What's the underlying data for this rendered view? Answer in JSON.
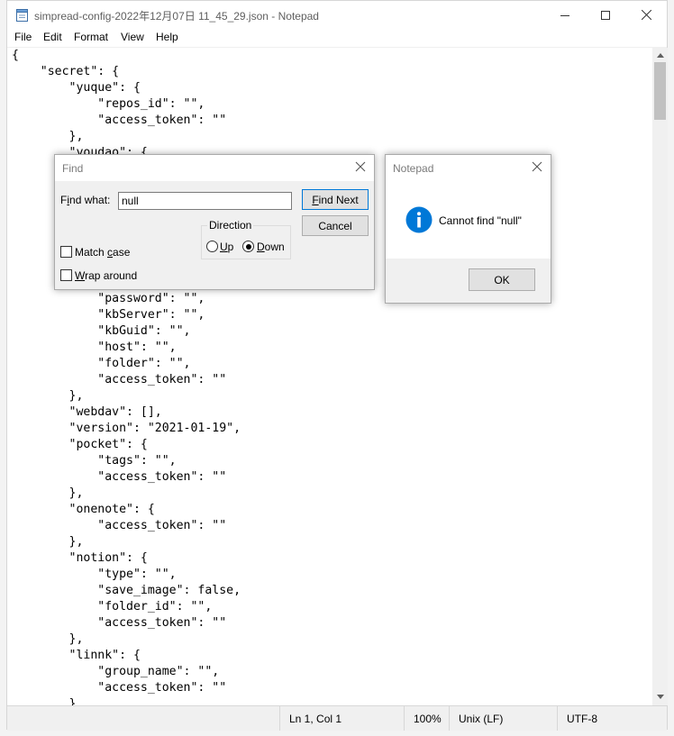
{
  "window": {
    "title": "simpread-config-2022年12月07日 11_45_29.json - Notepad"
  },
  "menu": [
    "File",
    "Edit",
    "Format",
    "View",
    "Help"
  ],
  "editor": {
    "lines": [
      "{",
      "    \"secret\": {",
      "        \"yuque\": {",
      "            \"repos_id\": \"\",",
      "            \"access_token\": \"\"",
      "        },",
      "        \"youdao\": {",
      "",
      "",
      "",
      "",
      "",
      "",
      "",
      "",
      "            \"password\": \"\",",
      "            \"kbServer\": \"\",",
      "            \"kbGuid\": \"\",",
      "            \"host\": \"\",",
      "            \"folder\": \"\",",
      "            \"access_token\": \"\"",
      "        },",
      "        \"webdav\": [],",
      "        \"version\": \"2021-01-19\",",
      "        \"pocket\": {",
      "            \"tags\": \"\",",
      "            \"access_token\": \"\"",
      "        },",
      "        \"onenote\": {",
      "            \"access_token\": \"\"",
      "        },",
      "        \"notion\": {",
      "            \"type\": \"\",",
      "            \"save_image\": false,",
      "            \"folder_id\": \"\",",
      "            \"access_token\": \"\"",
      "        },",
      "        \"linnk\": {",
      "            \"group_name\": \"\",",
      "            \"access_token\": \"\"",
      "        },"
    ]
  },
  "statusbar": {
    "position": "Ln 1, Col 1",
    "zoom": "100%",
    "line_endings": "Unix (LF)",
    "encoding": "UTF-8"
  },
  "find_dialog": {
    "title": "Find",
    "find_what_label": "Find what:",
    "find_what_value": "null",
    "find_next": "Find Next",
    "cancel": "Cancel",
    "direction_label": "Direction",
    "up_label": "Up",
    "down_label": "Down",
    "direction_selected": "down",
    "match_case_label": "Match case",
    "match_case_checked": false,
    "wrap_around_label": "Wrap around",
    "wrap_around_checked": false
  },
  "message_box": {
    "title": "Notepad",
    "message": "Cannot find \"null\"",
    "ok": "OK",
    "icon": "info-icon"
  },
  "colors": {
    "info_icon": "#0078d7",
    "default_button_border": "#0078d7"
  }
}
